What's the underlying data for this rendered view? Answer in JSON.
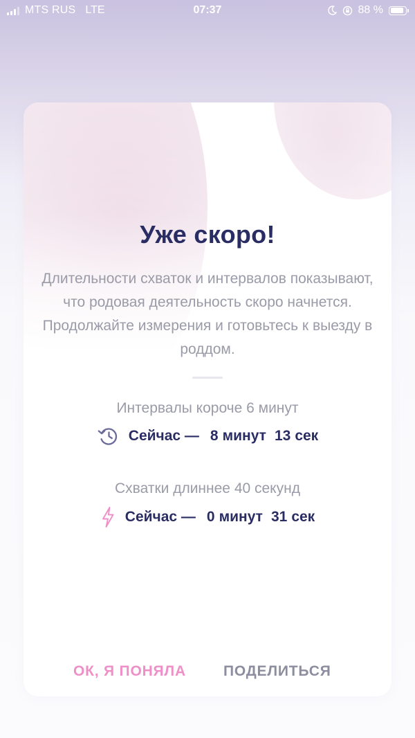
{
  "status_bar": {
    "carrier": "MTS RUS",
    "network": "LTE",
    "time": "07:37",
    "battery_text": "88 %",
    "battery_level": 0.88,
    "icons": [
      "signal-icon",
      "moon-icon",
      "orientation-lock-icon",
      "battery-icon"
    ]
  },
  "dialog": {
    "title": "Уже скоро!",
    "description": "Длительности схваток и интервалов показывают, что родовая деятельность скоро начнется. Продолжайте измерения и готовьтесь к выезду в роддом.",
    "intervals": {
      "label": "Интервалы короче 6 минут",
      "now": "Сейчас —",
      "minutes_value": "8",
      "minutes_unit": "минут",
      "seconds_value": "13",
      "seconds_unit": "сек",
      "icon": "history-clock-icon"
    },
    "contractions": {
      "label": "Схватки длиннее 40 секунд",
      "now": "Сейчас —",
      "minutes_value": "0",
      "minutes_unit": "минут",
      "seconds_value": "31",
      "seconds_unit": "сек",
      "icon": "lightning-icon"
    },
    "buttons": {
      "ok": "ОК, Я ПОНЯЛА",
      "share": "ПОДЕЛИТЬСЯ"
    }
  },
  "colors": {
    "title": "#2a2d63",
    "body_text": "#9a9ba8",
    "accent_pink": "#ef8fc7",
    "secondary_button": "#8c8d9f",
    "icon_purple": "#6b6a9a"
  }
}
